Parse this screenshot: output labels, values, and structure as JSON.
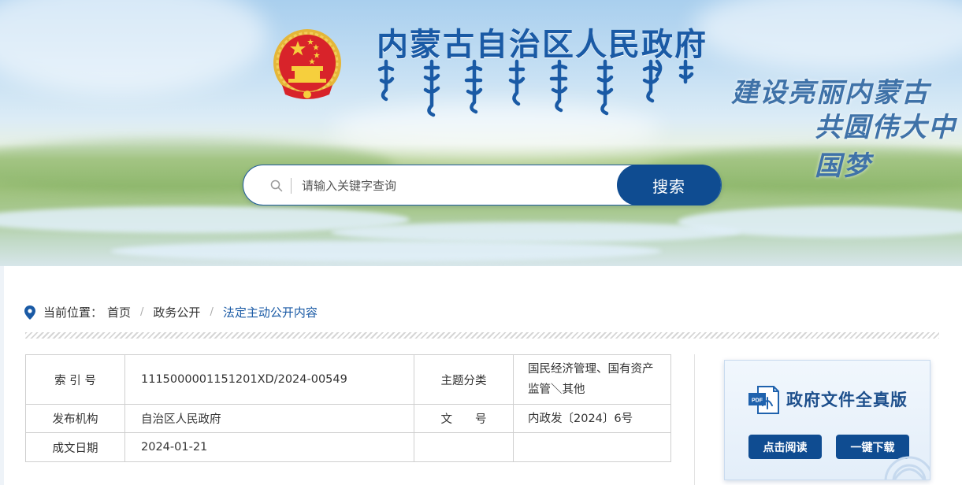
{
  "header": {
    "site_title": "内蒙古自治区人民政府",
    "slogan_line1": "建设亮丽内蒙古",
    "slogan_line2": "共圆伟大中国梦"
  },
  "search": {
    "placeholder": "请输入关键字查询",
    "value": "",
    "button_label": "搜索"
  },
  "breadcrumb": {
    "prefix": "当前位置：",
    "items": [
      "首页",
      "政务公开",
      "法定主动公开内容"
    ]
  },
  "document_info": {
    "index_label": "索 引 号",
    "index_value": "1115000001151201XD/2024-00549",
    "topic_label": "主题分类",
    "topic_value": "国民经济管理、国有资产监管＼其他",
    "issuer_label": "发布机构",
    "issuer_value": "自治区人民政府",
    "docno_label": "文　　号",
    "docno_value": "内政发〔2024〕6号",
    "date_label": "成文日期",
    "date_value": "2024-01-21"
  },
  "doc_card": {
    "title": "政府文件全真版",
    "icon_text": "PDF",
    "read_label": "点击阅读",
    "download_label": "一键下载"
  },
  "colors": {
    "brand_blue": "#0f4c91",
    "title_blue": "#1a5aa5",
    "border_gray": "#cfcfcf"
  }
}
